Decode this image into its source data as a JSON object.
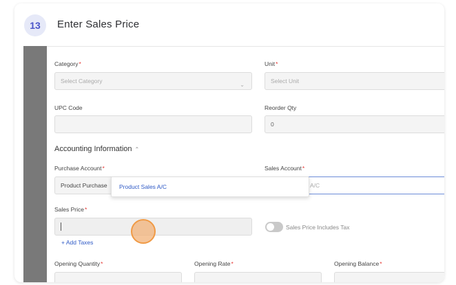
{
  "step": {
    "number": "13",
    "title": "Enter Sales Price"
  },
  "form": {
    "category": {
      "label": "Category",
      "placeholder": "Select Category"
    },
    "unit": {
      "label": "Unit",
      "placeholder": "Select Unit"
    },
    "upc": {
      "label": "UPC Code",
      "value": ""
    },
    "reorder": {
      "label": "Reorder Qty",
      "value": "0"
    },
    "accounting": {
      "title": "Accounting Information"
    },
    "purchase_account": {
      "label": "Purchase Account",
      "value": "Product Purchase"
    },
    "sales_account": {
      "label": "Sales Account",
      "value": "A/C"
    },
    "dropdown": {
      "option": "Product Sales A/C"
    },
    "sales_price": {
      "label": "Sales Price",
      "value": ""
    },
    "includes_tax": {
      "label": "Sales Price Includes Tax"
    },
    "add_taxes": {
      "label": "+ Add Taxes"
    },
    "opening_quantity": {
      "label": "Opening Quantity"
    },
    "opening_rate": {
      "label": "Opening Rate"
    },
    "opening_balance": {
      "label": "Opening Balance"
    },
    "required_mark": "*"
  }
}
